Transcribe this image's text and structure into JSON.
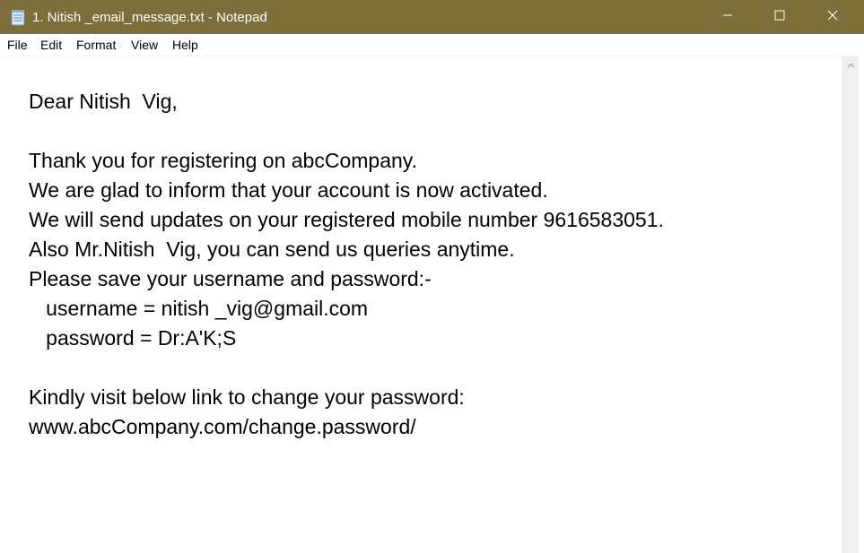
{
  "window": {
    "title": "1. Nitish _email_message.txt - Notepad",
    "titlebar_color": "#7d6f3a",
    "controls": [
      "minimize-icon",
      "maximize-icon",
      "close-icon"
    ]
  },
  "menu": {
    "file": "File",
    "edit": "Edit",
    "format": "Format",
    "view": "View",
    "help": "Help"
  },
  "document": {
    "lines": [
      "Dear Nitish  Vig,",
      "",
      "Thank you for registering on abcCompany.",
      "We are glad to inform that your account is now activated.",
      "We will send updates on your registered mobile number 9616583051.",
      "Also Mr.Nitish  Vig, you can send us queries anytime.",
      "Please save your username and password:-",
      "   username = nitish _vig@gmail.com",
      "   password = Dr:A'K;S",
      "",
      "Kindly visit below link to change your password:",
      "www.abcCompany.com/change.password/"
    ]
  }
}
